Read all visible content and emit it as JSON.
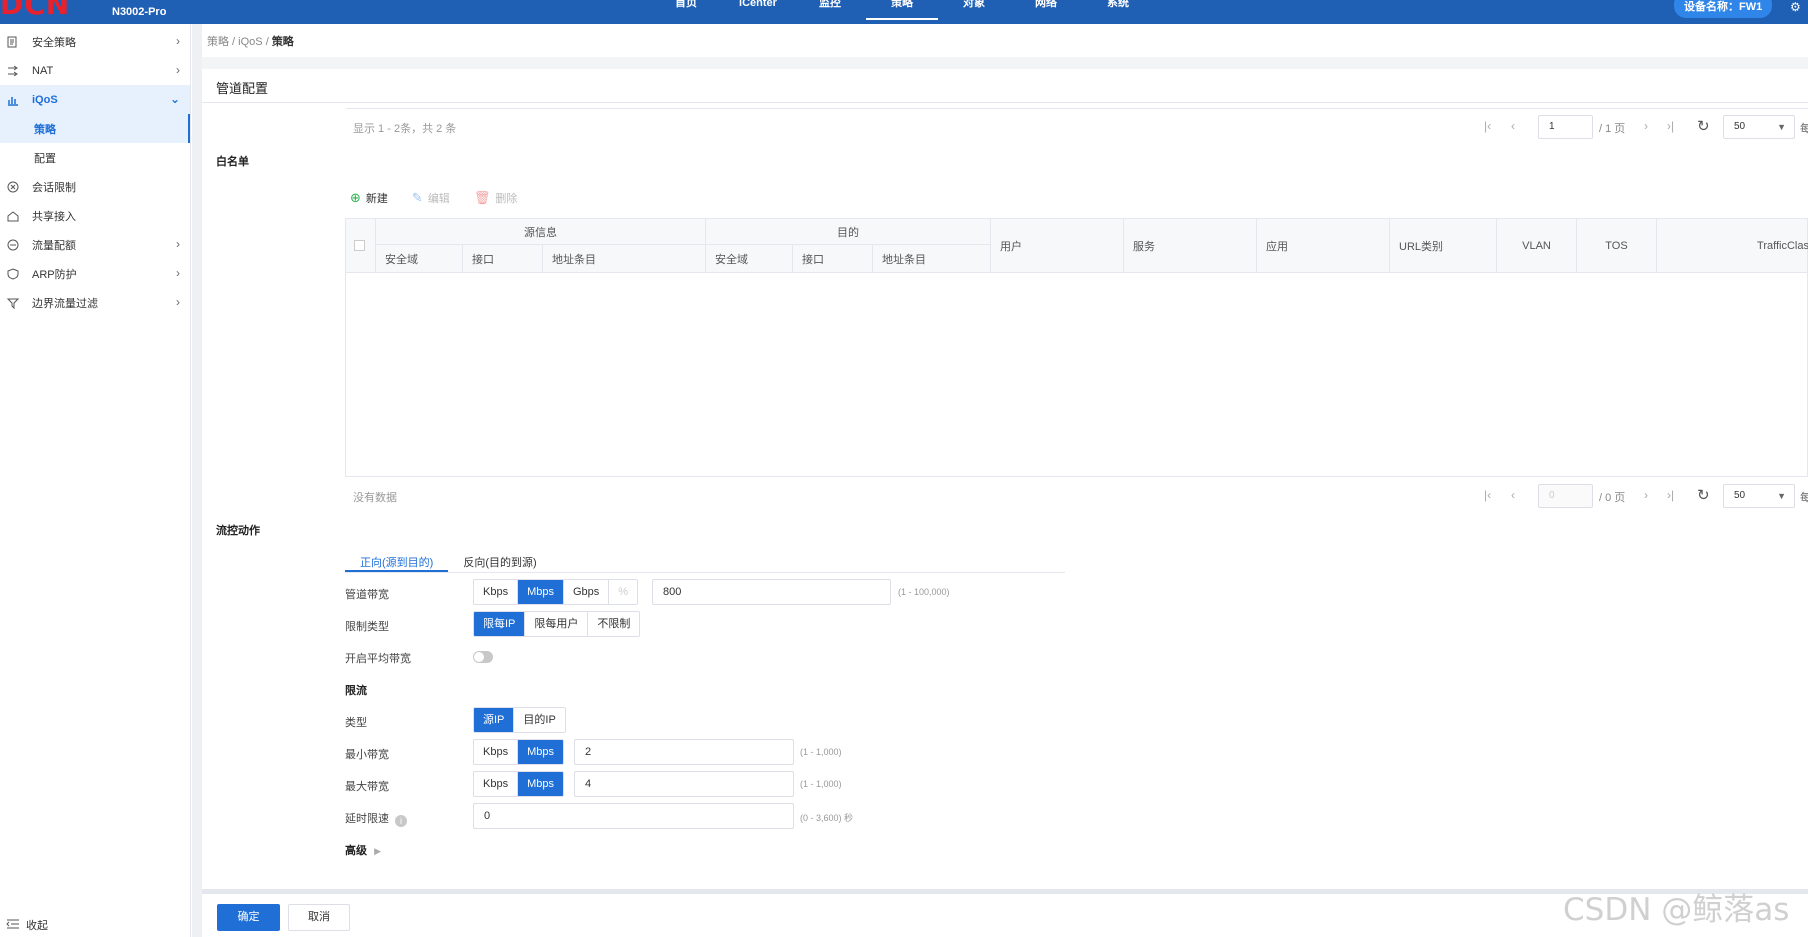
{
  "header": {
    "logo": "DCN",
    "model": "N3002-Pro",
    "nav": [
      "首页",
      "iCenter",
      "监控",
      "策略",
      "对象",
      "网络",
      "系统"
    ],
    "active_nav": "策略",
    "device_label": "设备名称：FW1"
  },
  "sidebar": {
    "items": [
      {
        "label": "安全策略",
        "icon": "policy-icon",
        "has_children": true
      },
      {
        "label": "NAT",
        "icon": "nat-icon",
        "has_children": true
      },
      {
        "label": "iQoS",
        "icon": "chart-icon",
        "has_children": true,
        "open": true
      },
      {
        "label": "会话限制",
        "icon": "session-icon",
        "has_children": false
      },
      {
        "label": "共享接入",
        "icon": "share-icon",
        "has_children": false
      },
      {
        "label": "流量配额",
        "icon": "quota-icon",
        "has_children": true
      },
      {
        "label": "ARP防护",
        "icon": "shield-icon",
        "has_children": true
      },
      {
        "label": "边界流量过滤",
        "icon": "filter-icon",
        "has_children": true
      }
    ],
    "sub_items": [
      {
        "label": "策略",
        "active": true
      },
      {
        "label": "配置",
        "active": false
      }
    ],
    "collapse_label": "收起"
  },
  "breadcrumb": {
    "parts": [
      "策略",
      "iQoS"
    ],
    "current": "策略",
    "sep": " / "
  },
  "page_title": "管道配置",
  "top_pager": {
    "info": "显示 1 - 2条，共 2 条",
    "page": "1",
    "total": "/ 1 页",
    "size": "50",
    "per_page": "每"
  },
  "whitelist": {
    "title": "白名单",
    "toolbar": {
      "new": "新建",
      "edit": "编辑",
      "delete": "删除"
    },
    "groups": {
      "source": "源信息",
      "dest": "目的"
    },
    "sub_columns": [
      "安全域",
      "接口",
      "地址条目",
      "安全域",
      "接口",
      "地址条目"
    ],
    "columns": [
      "用户",
      "服务",
      "应用",
      "URL类别",
      "VLAN",
      "TOS",
      "TrafficClas"
    ],
    "empty_text": "没有数据",
    "pager": {
      "page": "0",
      "total": "/ 0 页",
      "size": "50",
      "per_page": "每"
    }
  },
  "flow": {
    "title": "流控动作",
    "tabs": [
      "正向(源到目的)",
      "反向(目的到源)"
    ],
    "active_tab": 0,
    "bandwidth": {
      "label": "管道带宽",
      "units": [
        "Kbps",
        "Mbps",
        "Gbps",
        "%"
      ],
      "selected": "Mbps",
      "value": "800",
      "hint": "(1 - 100,000)"
    },
    "limit_type": {
      "label": "限制类型",
      "options": [
        "限每IP",
        "限每用户",
        "不限制"
      ],
      "selected": "限每IP"
    },
    "avg_bw": {
      "label": "开启平均带宽",
      "enabled": false
    },
    "rate_limit": {
      "title": "限流",
      "type": {
        "label": "类型",
        "options": [
          "源IP",
          "目的IP"
        ],
        "selected": "源IP"
      },
      "min_bw": {
        "label": "最小带宽",
        "units": [
          "Kbps",
          "Mbps"
        ],
        "selected": "Mbps",
        "value": "2",
        "hint": "(1 - 1,000)"
      },
      "max_bw": {
        "label": "最大带宽",
        "units": [
          "Kbps",
          "Mbps"
        ],
        "selected": "Mbps",
        "value": "4",
        "hint": "(1 - 1,000)"
      },
      "delay": {
        "label": "延时限速",
        "value": "0",
        "hint": "(0 - 3,600) 秒"
      }
    },
    "advanced_label": "高级"
  },
  "footer": {
    "ok": "确定",
    "cancel": "取消"
  },
  "watermark": "CSDN @鲸落as",
  "colors": {
    "primary": "#1f6fd6",
    "header": "#1f5fb4",
    "logo": "#e8212e"
  }
}
